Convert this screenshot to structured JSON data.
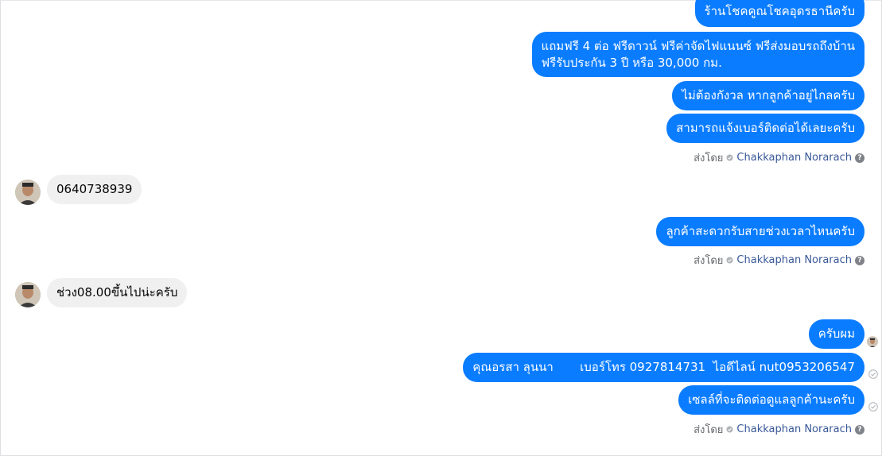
{
  "conversation": {
    "group1": {
      "msg1": "ร้านโชคคูณโชคอุดรธานีครับ",
      "msg2_line1": "แถมฟรี 4 ต่อ ฟรีดาวน์ ฟรีค่าจัดไฟแนนซ์ ฟรีส่งมอบรถถึงบ้าน",
      "msg2_line2": "ฟรีรับประกัน 3 ปี หรือ 30,000 กม.",
      "msg3": "ไม่ต้องกังวล หากลูกค้าอยู่ไกลครับ",
      "msg4": "สามารถแจ้งเบอร์ติดต่อได้เลยะครับ"
    },
    "incoming1": "0640738939",
    "group2": {
      "msg1": "ลูกค้าสะดวกรับสายช่วงเวลาไหนครับ"
    },
    "incoming2": "ช่วง08.00ขึ้นไปน่ะครับ",
    "group3": {
      "msg1": "ครับผม",
      "msg2": "คุณอรสา ลุนนา       เบอร์โทร 0927814731  ไอดีไลน์ nut0953206547",
      "msg3": "เซลล์ที่จะติดต่อดูแลลูกค้านะครับ"
    },
    "sent_by_label": "ส่งโดย",
    "sender_name": "Chakkaphan Norarach"
  },
  "colors": {
    "outgoing": "#0a7cff",
    "incoming": "#f0f0f0",
    "link": "#385898"
  }
}
